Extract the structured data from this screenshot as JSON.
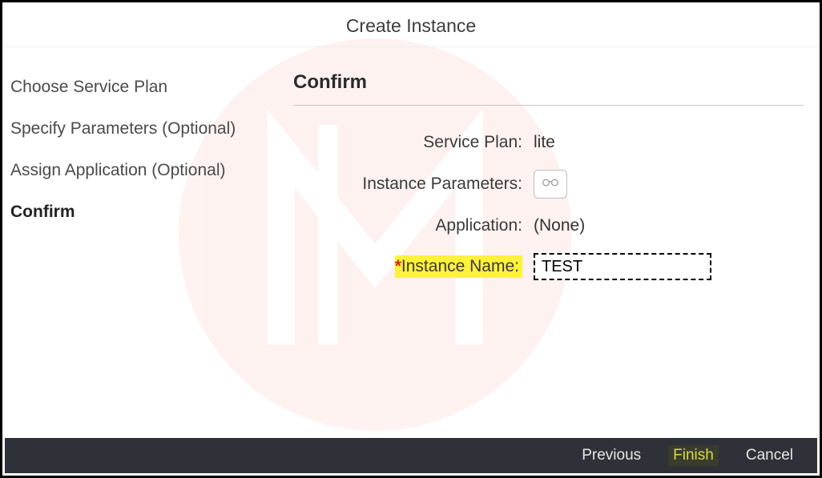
{
  "header": {
    "title": "Create Instance"
  },
  "sidebar": {
    "steps": [
      {
        "label": "Choose Service Plan",
        "active": false
      },
      {
        "label": "Specify Parameters (Optional)",
        "active": false
      },
      {
        "label": "Assign Application (Optional)",
        "active": false
      },
      {
        "label": "Confirm",
        "active": true
      }
    ]
  },
  "main": {
    "title": "Confirm",
    "fields": {
      "service_plan": {
        "label": "Service Plan:",
        "value": "lite"
      },
      "instance_parameters": {
        "label": "Instance Parameters:",
        "icon": "glasses-icon"
      },
      "application": {
        "label": "Application:",
        "value": "(None)"
      },
      "instance_name": {
        "label": "Instance Name:",
        "required_mark": "*",
        "value": "TEST"
      }
    }
  },
  "footer": {
    "previous": "Previous",
    "finish": "Finish",
    "cancel": "Cancel"
  }
}
